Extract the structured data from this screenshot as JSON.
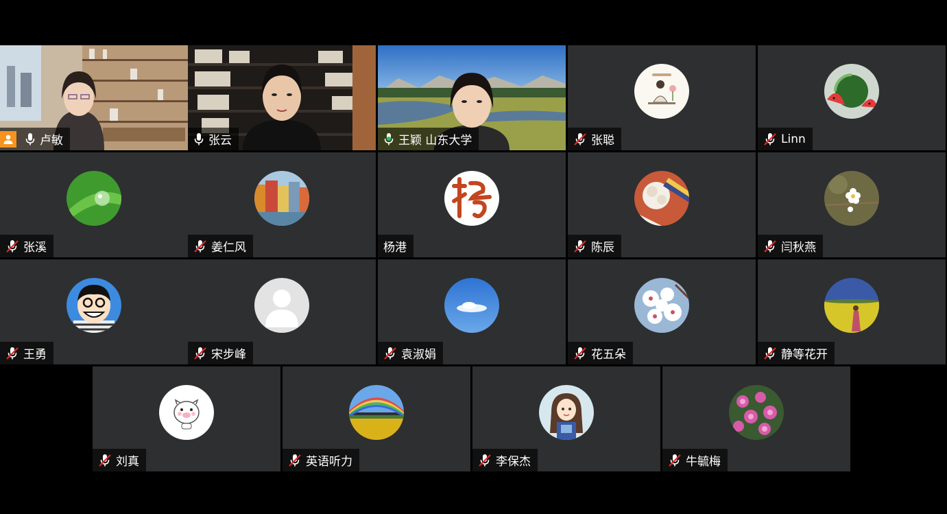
{
  "participants": [
    {
      "name": "卢敏",
      "mic": "on",
      "video": true,
      "host": true
    },
    {
      "name": "张云",
      "mic": "on",
      "video": true
    },
    {
      "name": "王颖 山东大学",
      "mic": "speaking",
      "video": true,
      "active": true
    },
    {
      "name": "张聪",
      "mic": "muted",
      "avatar_icon": "meditation-illustration-icon"
    },
    {
      "name": "Linn",
      "mic": "muted",
      "avatar_icon": "watermelon-icon"
    },
    {
      "name": "张溪",
      "mic": "muted",
      "avatar_icon": "water-drop-leaf-icon"
    },
    {
      "name": "姜仁风",
      "mic": "muted",
      "avatar_icon": "colorful-houses-icon"
    },
    {
      "name": "杨港",
      "mic": "none",
      "avatar_icon": "calligraphy-yang-icon"
    },
    {
      "name": "陈辰",
      "mic": "muted",
      "avatar_icon": "flower-bouquet-icon"
    },
    {
      "name": "闫秋燕",
      "mic": "muted",
      "avatar_icon": "white-blossom-icon"
    },
    {
      "name": "王勇",
      "mic": "muted",
      "avatar_icon": "cartoon-man-icon"
    },
    {
      "name": "宋步峰",
      "mic": "muted",
      "avatar_icon": "default-person-icon"
    },
    {
      "name": "袁淑娟",
      "mic": "muted",
      "avatar_icon": "cloud-sky-icon"
    },
    {
      "name": "花五朵",
      "mic": "muted",
      "avatar_icon": "cherry-blossom-icon"
    },
    {
      "name": "静等花开",
      "mic": "muted",
      "avatar_icon": "rapeseed-field-icon"
    },
    {
      "name": "刘真",
      "mic": "muted",
      "avatar_icon": "cute-pig-icon"
    },
    {
      "name": "英语听力",
      "mic": "muted",
      "avatar_icon": "rainbow-field-icon"
    },
    {
      "name": "李保杰",
      "mic": "muted",
      "avatar_icon": "cartoon-girl-icon"
    },
    {
      "name": "牛毓梅",
      "mic": "muted",
      "avatar_icon": "pink-flowers-icon"
    }
  ],
  "colors": {
    "active_border": "#23c552",
    "tile_bg": "#2e2f31",
    "host_badge": "#f7931e"
  }
}
